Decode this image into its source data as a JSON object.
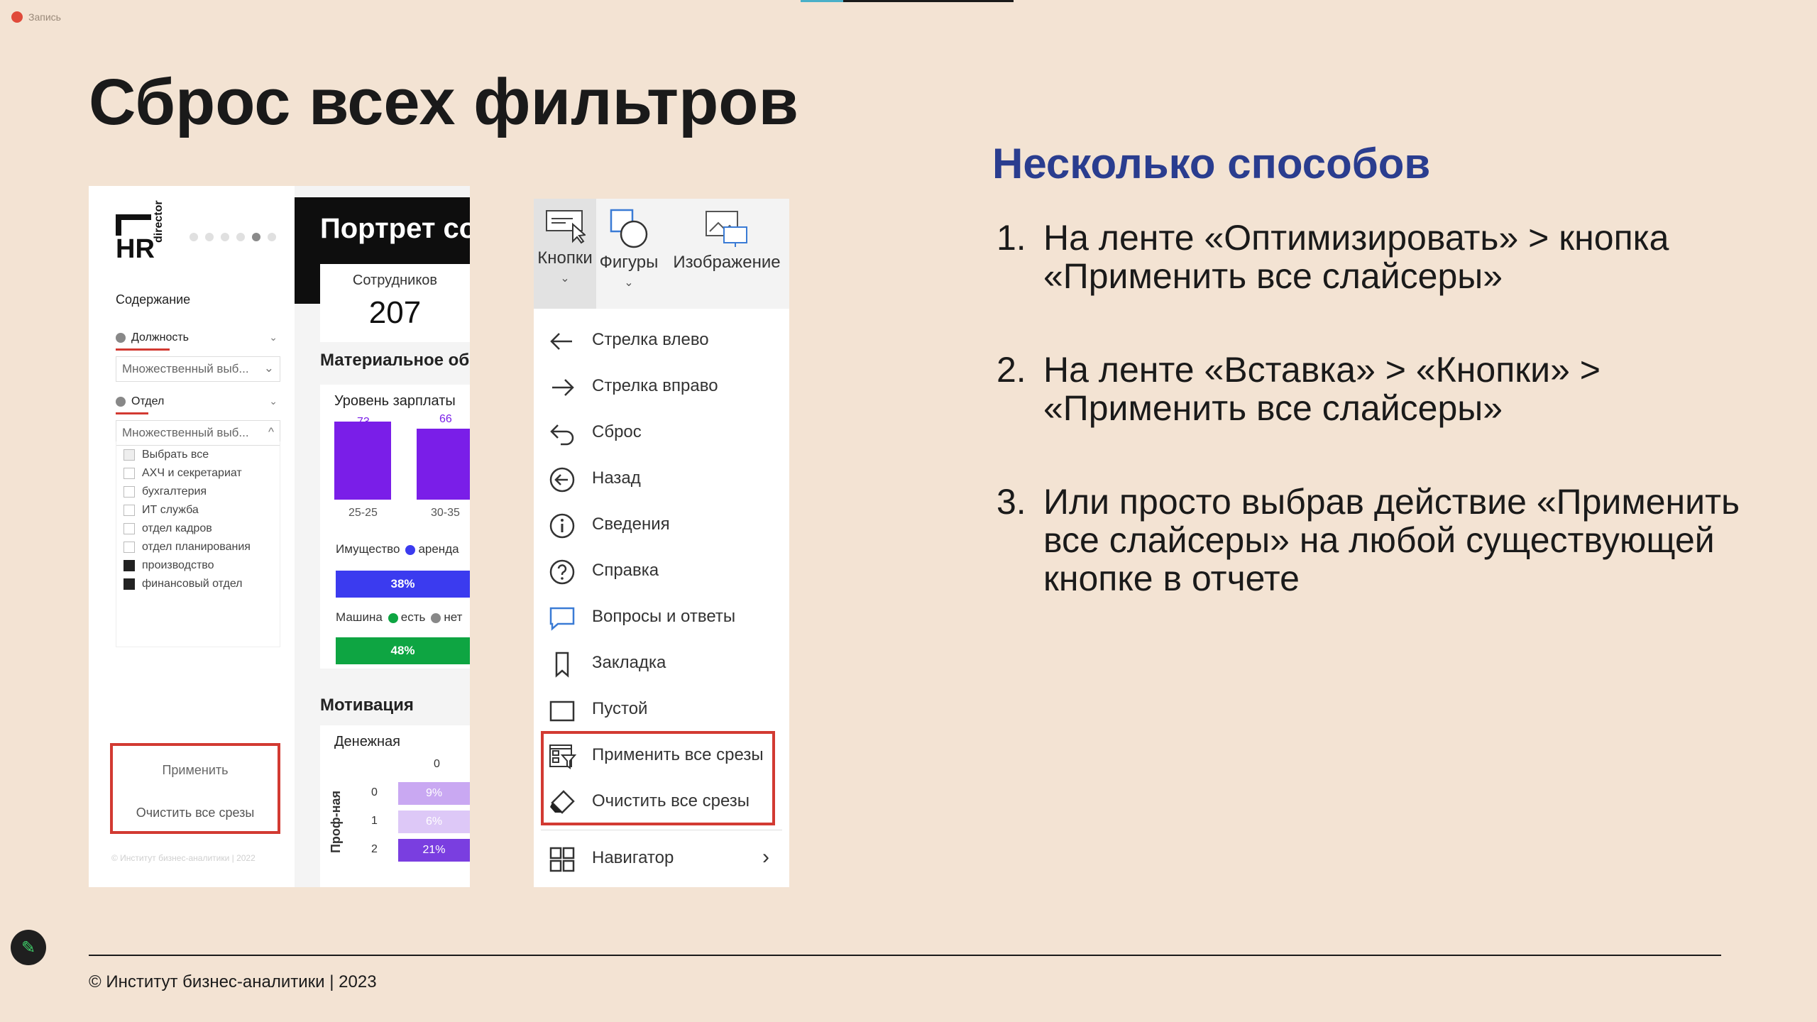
{
  "recording": {
    "label": "Запись"
  },
  "slide": {
    "title": "Сброс всех фильтров",
    "right_heading": "Несколько способов",
    "items": [
      {
        "num": "1.",
        "text": "На ленте «Оптимизировать» > кнопка «Применить все слайсеры»"
      },
      {
        "num": "2.",
        "text": "На ленте «Вставка» > «Кнопки» > «Применить все слайсеры»"
      },
      {
        "num": "3.",
        "text": "Или просто выбрав действие «Применить все слайсеры» на любой существующей кнопке в отчете"
      }
    ],
    "footer": "© Институт бизнес-аналитики | 2023"
  },
  "report": {
    "logo": {
      "hr": "HR",
      "director": "director"
    },
    "sidebar": {
      "heading": "Содержание",
      "filter1": "Должность",
      "filter1_value": "Множественный выб...",
      "filter2": "Отдел",
      "filter2_value": "Множественный выб...",
      "options": [
        {
          "label": "Выбрать все",
          "state": "partial"
        },
        {
          "label": "АХЧ и секретариат",
          "state": "off"
        },
        {
          "label": "бухгалтерия",
          "state": "off"
        },
        {
          "label": "ИТ служба",
          "state": "off"
        },
        {
          "label": "отдел кадров",
          "state": "off"
        },
        {
          "label": "отдел планирования",
          "state": "off"
        },
        {
          "label": "производство",
          "state": "on"
        },
        {
          "label": "финансовый отдел",
          "state": "on"
        }
      ],
      "apply_label": "Применить",
      "clear_label": "Очистить все срезы",
      "copyright": "© Институт бизнес-аналитики | 2022"
    },
    "main": {
      "title": "Портрет со",
      "kpi_label": "Сотрудников",
      "kpi_value": "207",
      "section_material": "Материальное об",
      "salary_label": "Уровень зарплаты",
      "salary_bars": [
        {
          "cat": "25-25",
          "value": "73"
        },
        {
          "cat": "30-35",
          "value": "66"
        }
      ],
      "property_label": "Имущество",
      "property_legend": "аренда",
      "property_pct": "38%",
      "car_label": "Машина",
      "car_yes": "есть",
      "car_no": "нет",
      "car_pct": "48%",
      "section_motivation": "Мотивация",
      "money_label": "Денежная",
      "money_col": "0",
      "prof_label": "Проф-ная",
      "heat_rows": [
        {
          "row": "0",
          "value": "9%"
        },
        {
          "row": "1",
          "value": "6%"
        },
        {
          "row": "2",
          "value": "21%"
        }
      ]
    }
  },
  "menu": {
    "ribbon": [
      {
        "label": "Кнопки",
        "selected": true
      },
      {
        "label": "Фигуры",
        "selected": false
      },
      {
        "label": "Изображение",
        "selected": false
      }
    ],
    "items": [
      {
        "label": "Стрелка влево",
        "icon": "arrow-left-icon"
      },
      {
        "label": "Стрелка вправо",
        "icon": "arrow-right-icon"
      },
      {
        "label": "Сброс",
        "icon": "reset-icon"
      },
      {
        "label": "Назад",
        "icon": "back-circle-icon"
      },
      {
        "label": "Сведения",
        "icon": "info-icon"
      },
      {
        "label": "Справка",
        "icon": "help-icon"
      },
      {
        "label": "Вопросы и ответы",
        "icon": "qa-icon"
      },
      {
        "label": "Закладка",
        "icon": "bookmark-icon"
      },
      {
        "label": "Пустой",
        "icon": "blank-icon"
      },
      {
        "label": "Применить все срезы",
        "icon": "apply-slicers-icon"
      },
      {
        "label": "Очистить все срезы",
        "icon": "eraser-icon"
      },
      {
        "label": "Навигатор",
        "icon": "grid-icon"
      }
    ]
  },
  "colors": {
    "accent_blue": "#2a3d8f",
    "highlight_red": "#d23a32",
    "purple": "#7a1ee8",
    "blue_bar": "#3b3bef",
    "green_bar": "#0ea542"
  }
}
